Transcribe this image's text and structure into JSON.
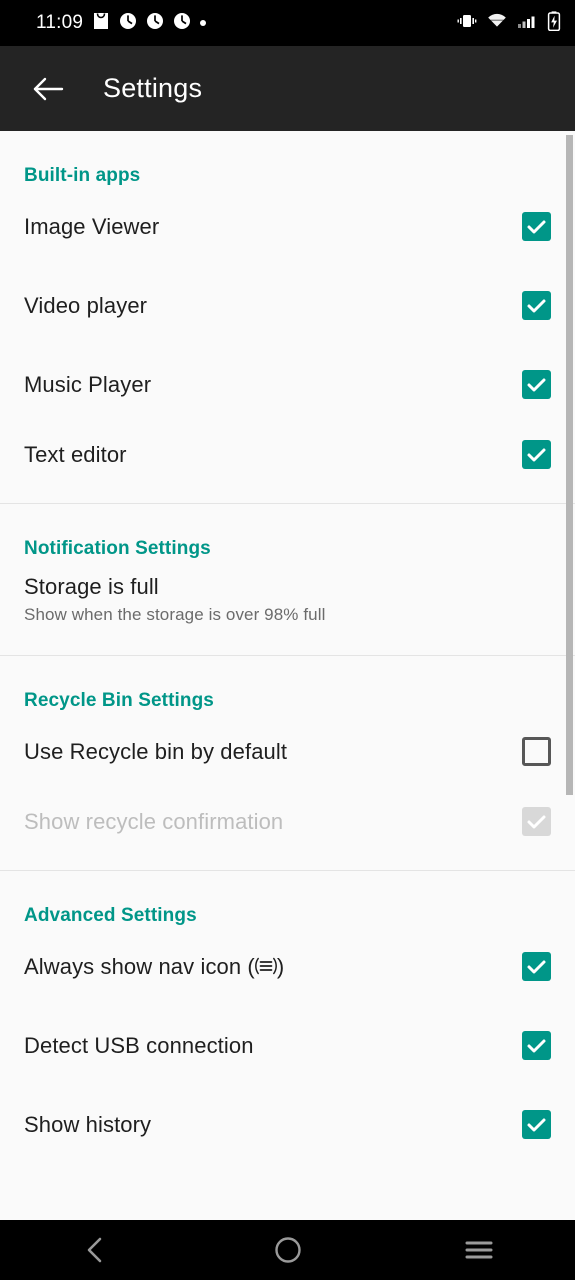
{
  "status_bar": {
    "time": "11:09",
    "left_icons": [
      "inbox-icon",
      "clock-icon",
      "clock-icon",
      "clock-icon",
      "dot-icon"
    ],
    "right_icons": [
      "vibrate-icon",
      "wifi-icon",
      "signal-icon",
      "battery-charging-icon"
    ]
  },
  "app_bar": {
    "back_label": "back-arrow",
    "title": "Settings"
  },
  "colors": {
    "accent": "#009688",
    "status_bar_bg": "#000000",
    "app_bar_bg": "#242424",
    "content_bg": "#fafafa",
    "divider": "#e4e4e4",
    "disabled_text": "#bdbdbd"
  },
  "sections": [
    {
      "title": "Built-in apps",
      "rows": [
        {
          "label": "Image Viewer",
          "sub": "",
          "checkbox": "checked",
          "enabled": true
        },
        {
          "label": "Video player",
          "sub": "",
          "checkbox": "checked",
          "enabled": true
        },
        {
          "label": "Music Player",
          "sub": "",
          "checkbox": "checked",
          "enabled": true
        },
        {
          "label": "Text editor",
          "sub": "",
          "checkbox": "checked",
          "enabled": true
        }
      ]
    },
    {
      "title": "Notification Settings",
      "rows": [
        {
          "label": "Storage is full",
          "sub": "Show when the storage is over 98% full",
          "checkbox": "none",
          "enabled": true
        }
      ]
    },
    {
      "title": "Recycle Bin Settings",
      "rows": [
        {
          "label": "Use Recycle bin by default",
          "sub": "",
          "checkbox": "unchecked",
          "enabled": true
        },
        {
          "label": "Show recycle confirmation",
          "sub": "",
          "checkbox": "disabled-checked",
          "enabled": false
        }
      ]
    },
    {
      "title": "Advanced Settings",
      "rows": [
        {
          "label": "Always show nav icon (",
          "label_suffix": ")",
          "nav_icon": true,
          "sub": "",
          "checkbox": "checked",
          "enabled": true
        },
        {
          "label": "Detect USB connection",
          "sub": "",
          "checkbox": "checked",
          "enabled": true
        },
        {
          "label": "Show history",
          "sub": "",
          "checkbox": "checked",
          "enabled": true
        }
      ]
    }
  ],
  "nav_bar": {
    "buttons": [
      "back-icon",
      "home-icon",
      "recents-icon"
    ]
  }
}
